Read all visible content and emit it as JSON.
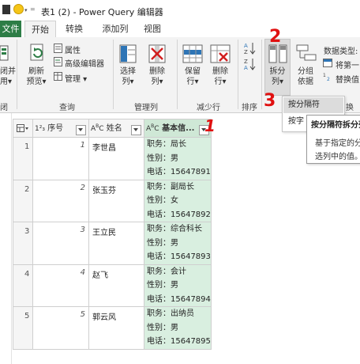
{
  "window": {
    "title": "表1 (2) - Power Query 编辑器"
  },
  "tabs": [
    "文件",
    "开始",
    "转换",
    "添加列",
    "视图"
  ],
  "ribbon": {
    "buttons": {
      "close_apply": [
        "闭并",
        "用▾"
      ],
      "refresh": [
        "刷新",
        "预览▾"
      ],
      "properties": "属性",
      "advanced_editor": "高级编辑器",
      "manage": "管理 ▾",
      "choose_columns": [
        "选择",
        "列▾"
      ],
      "remove_columns": [
        "删除",
        "列▾"
      ],
      "keep_rows": [
        "保留",
        "行▾"
      ],
      "remove_rows": [
        "删除",
        "行▾"
      ],
      "split_column": [
        "拆分",
        "列▾"
      ],
      "group_by": [
        "分组",
        "依据"
      ],
      "data_type": "数据类型: 文",
      "first_row": "将第一",
      "replace_values": "替换值"
    },
    "groups": {
      "close": "闭",
      "query": "查询",
      "manage_columns": "管理列",
      "reduce_rows": "减少行",
      "sort": "排序",
      "transform": "换"
    }
  },
  "menu": {
    "items": [
      "按分隔符",
      "按字"
    ],
    "tooltip_title": "按分隔符拆分列",
    "tooltip_body": [
      "基于指定的分",
      "选列中的值。"
    ]
  },
  "annotations": [
    "1",
    "2",
    "3"
  ],
  "table": {
    "columns": [
      "序号",
      "姓名",
      "基本信..."
    ],
    "rows": [
      {
        "num": "1",
        "idx": "1",
        "name": "李世昌",
        "info": [
          "职务：局长",
          "性别：男",
          "电话：15647891"
        ]
      },
      {
        "num": "2",
        "idx": "2",
        "name": "张玉芬",
        "info": [
          "职务：副局长",
          "性别：女",
          "电话：15647892"
        ]
      },
      {
        "num": "3",
        "idx": "3",
        "name": "王立民",
        "info": [
          "职务：综合科长",
          "性别：男",
          "电话：15647893"
        ]
      },
      {
        "num": "4",
        "idx": "4",
        "name": "赵飞",
        "info": [
          "职务：会计",
          "性别：男",
          "电话：15647894"
        ]
      },
      {
        "num": "5",
        "idx": "5",
        "name": "郭云风",
        "info": [
          "职务：出纳员",
          "性别：男",
          "电话：15647895"
        ]
      }
    ]
  },
  "colors": {
    "file_tab": "#2d7d46",
    "selected_column": "#d9efe0",
    "annotation": "#e01010"
  }
}
